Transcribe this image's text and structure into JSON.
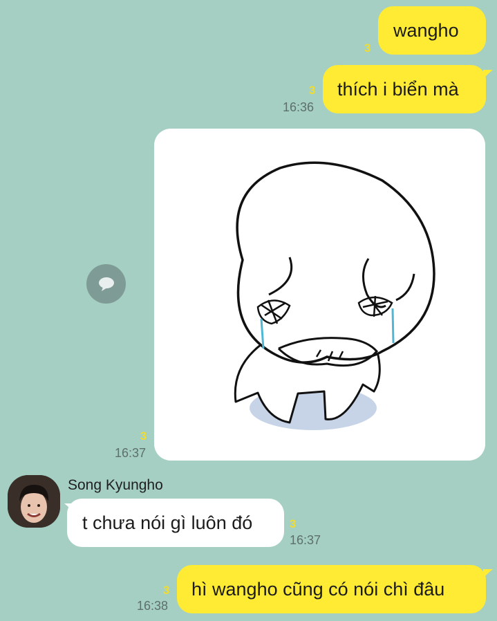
{
  "colors": {
    "background": "#a4cfc2",
    "my_bubble": "#ffeb33",
    "other_bubble": "#ffffff",
    "unread": "#f2dc2e",
    "time": "#5d6f69"
  },
  "messages": [
    {
      "sender": "me",
      "text": "wangho",
      "unread": "3",
      "time": ""
    },
    {
      "sender": "me",
      "text": "thích i biển mà",
      "unread": "3",
      "time": "16:36"
    },
    {
      "sender": "me",
      "type": "sticker",
      "sticker": "crying-character-sticker",
      "unread": "3",
      "time": "16:37"
    },
    {
      "sender": "Song Kyungho",
      "text": "t chưa nói gì luôn đó",
      "unread": "3",
      "time": "16:37"
    },
    {
      "sender": "me",
      "text": "hì wangho cũng có nói chì đâu",
      "unread": "3",
      "time": "16:38"
    }
  ],
  "icons": {
    "sticker_reply": "speech-bubble-icon",
    "avatar": "profile-photo"
  }
}
